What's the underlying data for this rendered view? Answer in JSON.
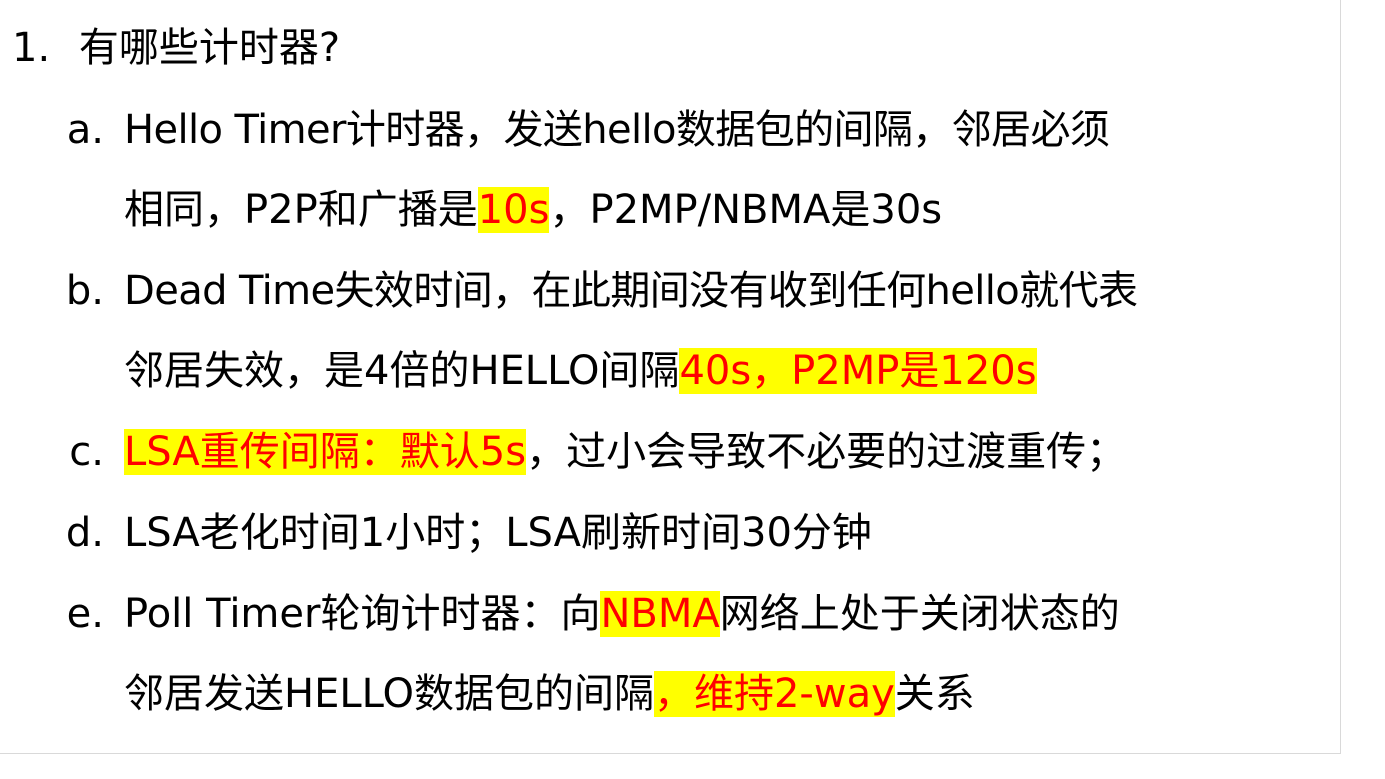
{
  "heading": {
    "number": "1.",
    "text": "有哪些计时器?"
  },
  "items": [
    {
      "marker": "a.",
      "line1": "Hello Timer计时器，发送hello数据包的间隔，邻居必须",
      "line2_pre": "相同，P2P和广播是",
      "line2_hl": "10s",
      "line2_post": "，P2MP/NBMA是30s"
    },
    {
      "marker": "b.",
      "line1": "Dead Time失效时间，在此期间没有收到任何hello就代表",
      "line2_pre": "邻居失效，是4倍的HELLO间隔",
      "line2_hl": "40s，P2MP是120s"
    },
    {
      "marker": "c.",
      "line1_hl": "LSA重传间隔：默认5s",
      "line1_post": "，过小会导致不必要的过渡重传；"
    },
    {
      "marker": "d.",
      "line1": "LSA老化时间1小时；LSA刷新时间30分钟"
    },
    {
      "marker": "e.",
      "line1_pre": "Poll Timer轮询计时器：向",
      "line1_hl": "NBMA",
      "line1_post": "网络上处于关闭状态的",
      "line2_pre": "邻居发送HELLO数据包的间隔",
      "line2_hl": "，维持2-way",
      "line2_post": "关系"
    }
  ],
  "colors": {
    "highlight_bg": "#ffff00",
    "highlight_text": "#ff0000",
    "text": "#000000"
  }
}
